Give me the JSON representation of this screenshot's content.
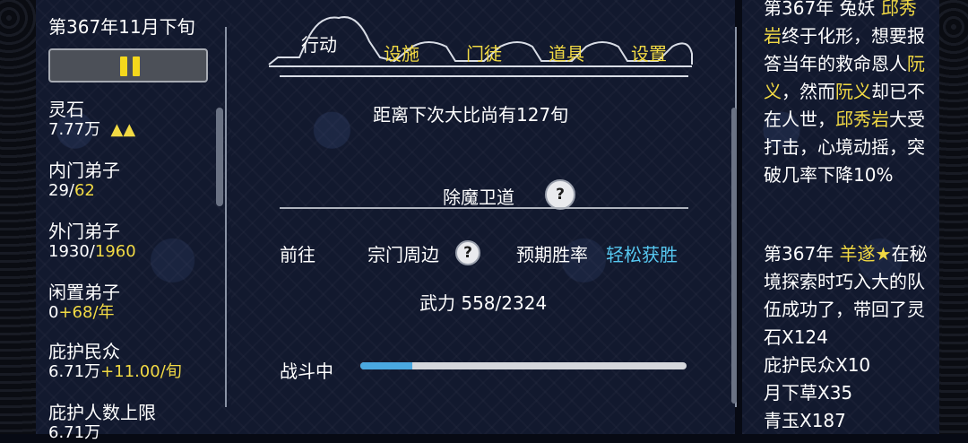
{
  "left": {
    "date": "第367年11月下旬",
    "stats": [
      {
        "label": "灵石",
        "value": "7.77万",
        "extra": "▲▲"
      },
      {
        "label": "内门弟子",
        "value": "29/",
        "extra": "62"
      },
      {
        "label": "外门弟子",
        "value": "1930/",
        "extra": "1960"
      },
      {
        "label": "闲置弟子",
        "value": "0",
        "extra": "+68/年"
      },
      {
        "label": "庇护民众",
        "value": "6.71万",
        "extra": "+11.00/旬"
      },
      {
        "label": "庇护人数上限",
        "value": "6.71万",
        "extra": ""
      }
    ]
  },
  "tabs": [
    {
      "label": "行动",
      "active": true
    },
    {
      "label": "设施",
      "active": false
    },
    {
      "label": "门徒",
      "active": false
    },
    {
      "label": "道具",
      "active": false
    },
    {
      "label": "设置",
      "active": false
    }
  ],
  "center": {
    "countdown": "距离下次大比尚有127旬",
    "mission_title": "除魔卫道",
    "help_glyph": "?",
    "go_label": "前往",
    "location": "宗门周边",
    "win_rate_label": "预期胜率",
    "win_rate_value": "轻松获胜",
    "power": "武力 558/2324",
    "battle_label": "战斗中",
    "battle_progress": 0.16
  },
  "log": {
    "entry1": {
      "p1": "第367年 兔妖",
      "n1": "邱秀岩",
      "p2": "终于化形，想要报答当年的救命恩人",
      "n2": "阮义",
      "p3": "，然而",
      "n3": "阮义",
      "p4": "却已不在人世，",
      "n4": "邱秀岩",
      "p5": "大受打击，心境动摇，突破几率下降10%"
    },
    "entry2": {
      "p1": "第367年",
      "n1": "羊遂",
      "star": "★",
      "p2": "在秘境探索时巧入大的队伍成功了，带回了灵石X124",
      "l2": "庇护民众X10",
      "l3": "月下草X35",
      "l4": "青玉X187"
    }
  }
}
